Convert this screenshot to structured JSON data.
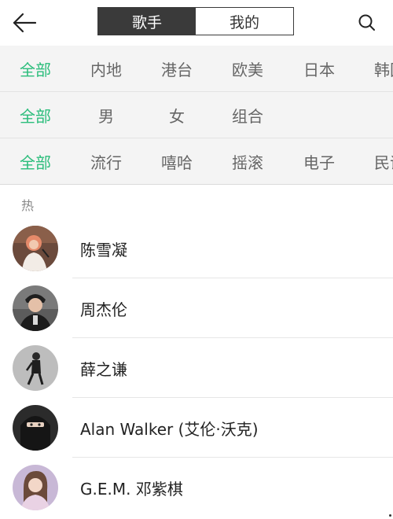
{
  "header": {
    "tabs": [
      {
        "label": "歌手",
        "active": true
      },
      {
        "label": "我的",
        "active": false
      }
    ]
  },
  "filters": {
    "region": [
      "全部",
      "内地",
      "港台",
      "欧美",
      "日本",
      "韩国"
    ],
    "gender": [
      "全部",
      "男",
      "女",
      "组合"
    ],
    "genre": [
      "全部",
      "流行",
      "嘻哈",
      "摇滚",
      "电子",
      "民谣"
    ]
  },
  "section": {
    "hot_label": "热"
  },
  "singers": [
    {
      "name": "陈雪凝"
    },
    {
      "name": "周杰伦"
    },
    {
      "name": "薛之谦"
    },
    {
      "name": "Alan Walker (艾伦·沃克)"
    },
    {
      "name": "G.E.M. 邓紫棋"
    }
  ],
  "colors": {
    "accent": "#2bbd7b",
    "header_active_bg": "#3a3a3a",
    "filter_bg": "#f4f4f4"
  },
  "icons": {
    "back": "arrow-left-icon",
    "search": "search-icon"
  }
}
